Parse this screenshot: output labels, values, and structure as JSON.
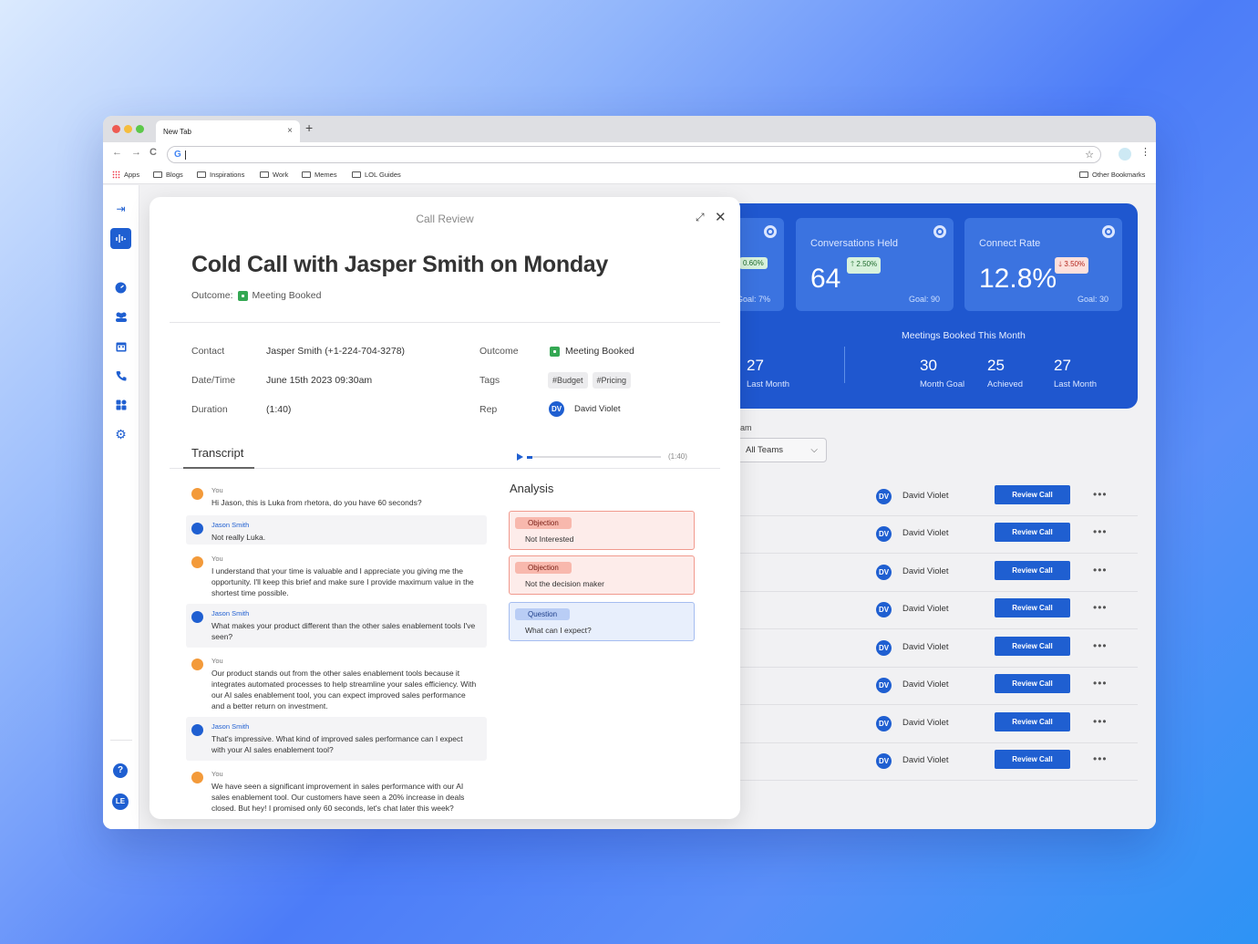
{
  "browser": {
    "tab_title": "New Tab",
    "tab_close": "×",
    "new_tab": "+",
    "back": "←",
    "forward": "→",
    "reload": "C",
    "google_g": "G",
    "star": "☆",
    "menu": "⋮",
    "bookmarks": [
      "Apps",
      "Blogs",
      "Inspirations",
      "Work",
      "Memes",
      "LOL Guides"
    ],
    "other_bookmarks": "Other Bookmarks"
  },
  "sidebar": {
    "help_label": "?",
    "user_initials": "LE"
  },
  "stats": {
    "cards": [
      {
        "label": "",
        "value": "",
        "change": "0.60%",
        "goal": "Goal: 7%",
        "direction": "up"
      },
      {
        "label": "Conversations Held",
        "value": "64",
        "change": "2.50%",
        "goal": "Goal: 90",
        "direction": "up"
      },
      {
        "label": "Connect Rate",
        "value": "12.8%",
        "change": "3.50%",
        "goal": "Goal: 30",
        "direction": "down"
      }
    ],
    "left_group": {
      "value": "27",
      "label": "Last Month"
    },
    "meetings_title": "Meetings Booked This Month",
    "meetings": [
      {
        "value": "30",
        "label": "Month Goal"
      },
      {
        "value": "25",
        "label": "Achieved"
      },
      {
        "value": "27",
        "label": "Last Month"
      }
    ],
    "colors": {
      "panel": "#1f57cf",
      "card": "#3b73e0"
    }
  },
  "team_filter": {
    "label": "eam",
    "selected": "All Teams"
  },
  "calls_table": {
    "rows": [
      {
        "rep_initials": "DV",
        "rep": "David Violet",
        "action": "Review Call"
      },
      {
        "rep_initials": "DV",
        "rep": "David Violet",
        "action": "Review Call"
      },
      {
        "rep_initials": "DV",
        "rep": "David Violet",
        "action": "Review Call"
      },
      {
        "rep_initials": "DV",
        "rep": "David Violet",
        "action": "Review Call"
      },
      {
        "rep_initials": "DV",
        "rep": "David Violet",
        "action": "Review Call"
      },
      {
        "rep_initials": "DV",
        "rep": "David Violet",
        "action": "Review Call"
      },
      {
        "rep_initials": "DV",
        "rep": "David Violet",
        "action": "Review Call"
      },
      {
        "rep_initials": "DV",
        "rep": "David Violet",
        "action": "Review Call"
      }
    ],
    "more_label": "•••"
  },
  "modal": {
    "header": "Call Review",
    "expand": "⤢",
    "close": "✕",
    "title": "Cold Call with Jasper Smith on Monday",
    "outcome_label": "Outcome:",
    "outcome_value": "Meeting Booked",
    "details": {
      "contact_label": "Contact",
      "contact_value": "Jasper Smith (+1-224-704-3278)",
      "date_label": "Date/Time",
      "date_value": "June 15th 2023 09:30am",
      "duration_label": "Duration",
      "duration_value": "(1:40)",
      "outcome_label": "Outcome",
      "outcome_value": "Meeting Booked",
      "tags_label": "Tags",
      "tags": [
        "#Budget",
        "#Pricing"
      ],
      "rep_label": "Rep",
      "rep_initials": "DV",
      "rep_value": "David Violet"
    },
    "transcript_tab": "Transcript",
    "player": {
      "duration": "(1:40)",
      "progress": 0.04
    },
    "transcript": [
      {
        "speaker": "You",
        "text": "Hi Jason, this is Luka from rhetora, do you have 60 seconds?"
      },
      {
        "speaker": "Jason Smith",
        "text": "Not really Luka."
      },
      {
        "speaker": "You",
        "text": "I understand that your time is valuable and I appreciate you giving me the opportunity. I'll keep this brief and make sure I provide maximum value in the shortest time possible."
      },
      {
        "speaker": "Jason Smith",
        "text": "What makes your product different than the other sales enablement tools I've seen?"
      },
      {
        "speaker": "You",
        "text": "Our product stands out from the other sales enablement tools because it integrates automated processes to help streamline your sales efficiency. With our AI sales enablement tool, you can expect improved sales performance and a better return on investment."
      },
      {
        "speaker": "Jason Smith",
        "text": "That's impressive. What kind of improved sales performance can I expect with your AI sales enablement tool?"
      },
      {
        "speaker": "You",
        "text": "We have seen a significant improvement in sales performance with our AI sales enablement tool. Our customers have seen a 20% increase in deals closed. But hey! I promised only 60 seconds, let's chat later this week?"
      }
    ],
    "analysis_title": "Analysis",
    "analysis": [
      {
        "type": "Objection",
        "text": "Not Interested"
      },
      {
        "type": "Objection",
        "text": "Not the decision maker"
      },
      {
        "type": "Question",
        "text": "What can I expect?"
      }
    ]
  }
}
